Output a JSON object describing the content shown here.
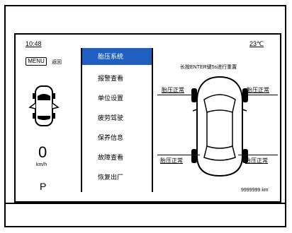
{
  "status": {
    "time": "10:48",
    "temperature": "23℃"
  },
  "left_panel": {
    "menu_button": "MENU",
    "menu_hint": "返回",
    "speed": "0",
    "speed_unit": "km/h",
    "gear": "P"
  },
  "menu": {
    "items": [
      {
        "label": "胎压系统",
        "selected": true
      },
      {
        "label": "报警查看",
        "selected": false
      },
      {
        "label": "单位设置",
        "selected": false
      },
      {
        "label": "疲劳驾驶",
        "selected": false
      },
      {
        "label": "保养信息",
        "selected": false
      },
      {
        "label": "故障查看",
        "selected": false
      },
      {
        "label": "恢复出厂",
        "selected": false
      }
    ],
    "selected_color": "#1f5fbf"
  },
  "tire_panel": {
    "instruction": "长按ENTER键5s进行重置",
    "front_left": "胎压正常",
    "front_right": "胎压正常",
    "rear_left": "胎压正常",
    "rear_right": "胎压正常",
    "odometer": "9999999 km"
  }
}
